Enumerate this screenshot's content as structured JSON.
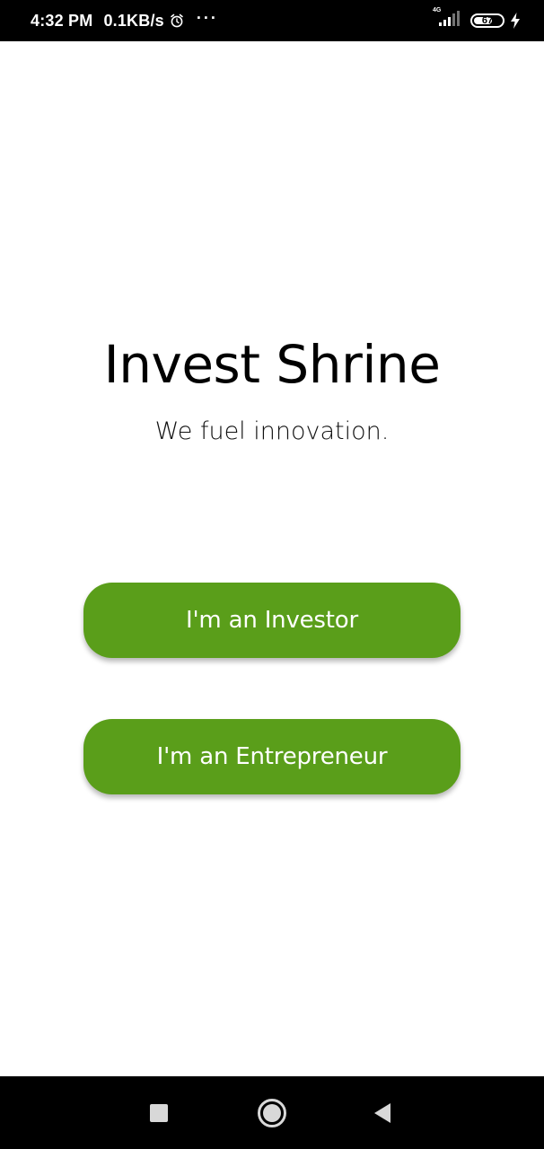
{
  "status_bar": {
    "time": "4:32 PM",
    "network_speed": "0.1KB/s",
    "alarm_icon": "alarm-clock-icon",
    "more_icon": "more-dots-icon",
    "more_text": "···",
    "network_type": "4G",
    "signal_icon": "cell-signal-icon",
    "battery_level": "67",
    "battery_fraction": 0.67,
    "charging_icon": "charging-bolt-icon"
  },
  "main": {
    "title": "Invest Shrine",
    "tagline": "We fuel innovation.",
    "investor_button_label": "I'm an Investor",
    "entrepreneur_button_label": "I'm an Entrepreneur"
  },
  "nav_bar": {
    "recents_icon": "square-recents-icon",
    "home_icon": "circle-home-icon",
    "back_icon": "triangle-back-icon"
  },
  "colors": {
    "accent": "#5a9e1a",
    "background": "#ffffff",
    "system_bars": "#000000"
  }
}
